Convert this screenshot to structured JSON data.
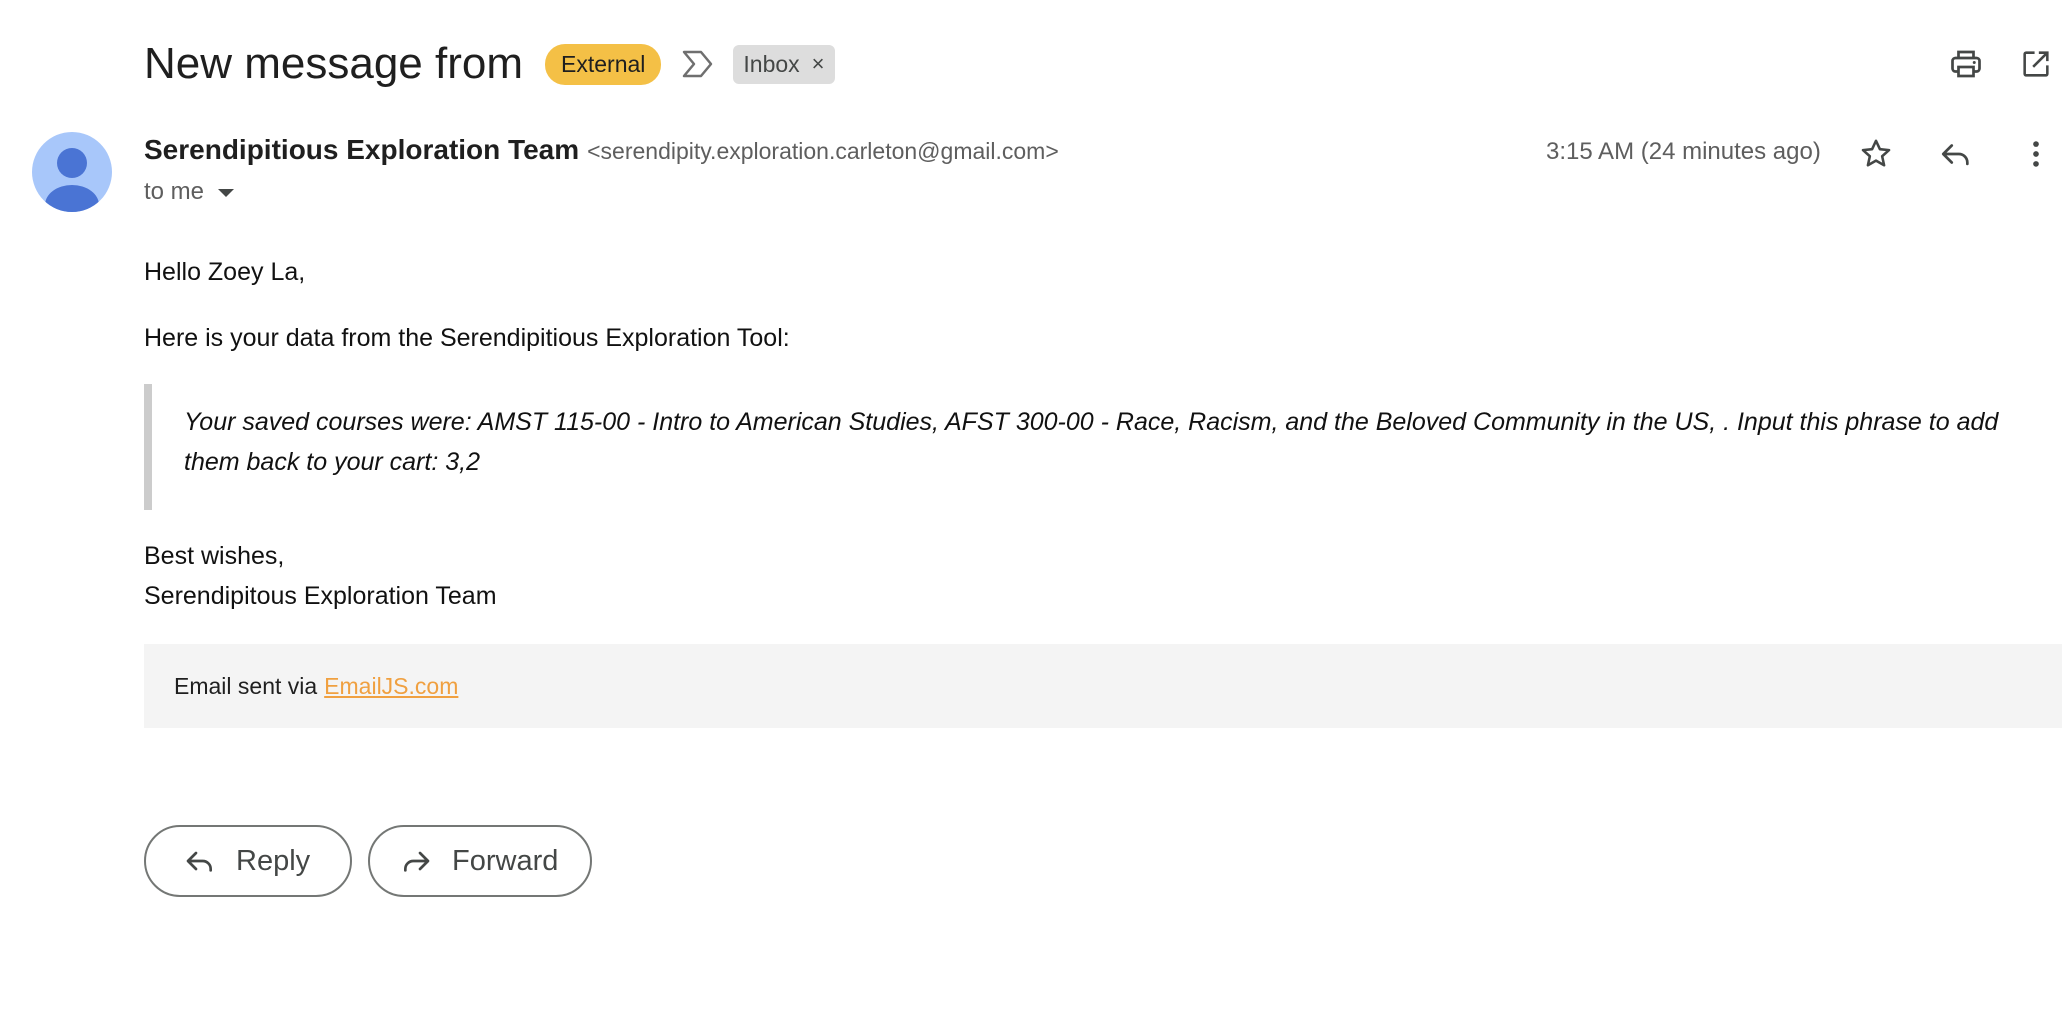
{
  "header": {
    "subject": "New message from",
    "external_label": "External",
    "inbox_label": "Inbox",
    "inbox_remove": "×"
  },
  "sender": {
    "name": "Serendipitious Exploration Team",
    "email": "<serendipity.exploration.carleton@gmail.com>",
    "recipient": "to me",
    "timestamp": "3:15 AM (24 minutes ago)"
  },
  "message": {
    "greeting": "Hello Zoey La,",
    "intro": "Here is your data from the Serendipitious Exploration Tool:",
    "quote": "Your saved courses were: AMST 115-00 - Intro to American Studies, AFST 300-00 - Race, Racism, and the Beloved Community in the US, . Input this phrase to add them back to your cart: 3,2",
    "closing": "Best wishes,",
    "signature": "Serendipitous Exploration Team"
  },
  "footer": {
    "prefix": "Email sent via",
    "link": "EmailJS.com"
  },
  "actions": {
    "reply_label": "Reply",
    "forward_label": "Forward"
  },
  "icons": {
    "important": "important-marker-icon",
    "print": "print-icon",
    "popout": "open-in-new-window-icon",
    "star": "star-icon",
    "reply": "reply-icon",
    "more": "more-vertical-icon",
    "forward": "forward-icon",
    "avatar": "person-avatar-icon"
  },
  "colors": {
    "external_badge": "#f4c046",
    "link": "#f0a040",
    "avatar_bg": "#a8c7fa",
    "avatar_fg": "#4a74d4"
  }
}
